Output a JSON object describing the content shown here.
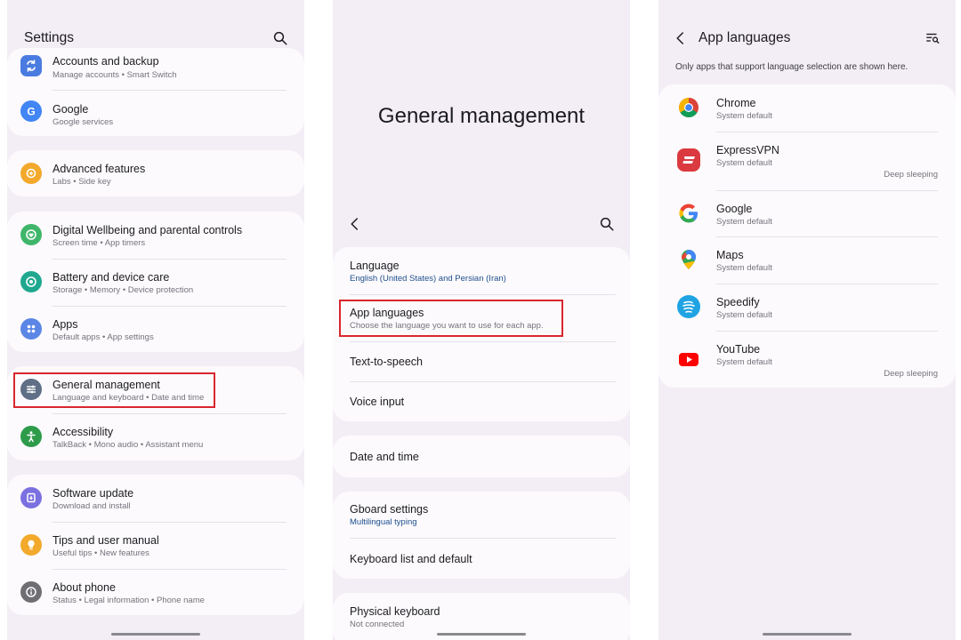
{
  "settings": {
    "title": "Settings",
    "groups": [
      {
        "items": [
          {
            "title": "Accounts and backup",
            "sub": "Manage accounts  •  Smart Switch",
            "icon": "sync-icon",
            "color": "#4a7be0"
          },
          {
            "title": "Google",
            "sub": "Google services",
            "icon": "google-g-icon",
            "color": "#4285f4"
          }
        ]
      },
      {
        "items": [
          {
            "title": "Advanced features",
            "sub": "Labs  •  Side key",
            "icon": "gear-plus-icon",
            "color": "#f3a92c"
          }
        ]
      },
      {
        "items": [
          {
            "title": "Digital Wellbeing and parental controls",
            "sub": "Screen time  •  App timers",
            "icon": "wellbeing-icon",
            "color": "#3fb66a"
          },
          {
            "title": "Battery and device care",
            "sub": "Storage  •  Memory  •  Device protection",
            "icon": "device-care-icon",
            "color": "#1fa88f"
          },
          {
            "title": "Apps",
            "sub": "Default apps  •  App settings",
            "icon": "apps-grid-icon",
            "color": "#5c86e6"
          }
        ]
      },
      {
        "items": [
          {
            "title": "General management",
            "sub": "Language and keyboard  •  Date and time",
            "icon": "sliders-icon",
            "color": "#5f6f86"
          },
          {
            "title": "Accessibility",
            "sub": "TalkBack  •  Mono audio  •  Assistant menu",
            "icon": "accessibility-icon",
            "color": "#2e9b4b"
          }
        ]
      },
      {
        "items": [
          {
            "title": "Software update",
            "sub": "Download and install",
            "icon": "update-icon",
            "color": "#7b70e0"
          },
          {
            "title": "Tips and user manual",
            "sub": "Useful tips  •  New features",
            "icon": "lightbulb-icon",
            "color": "#f3a92c"
          },
          {
            "title": "About phone",
            "sub": "Status  •  Legal information  •  Phone name",
            "icon": "info-icon",
            "color": "#6e6e73"
          }
        ]
      }
    ]
  },
  "general": {
    "title": "General management",
    "groups": [
      {
        "items": [
          {
            "title": "Language",
            "sub": "English (United States) and Persian (Iran)",
            "sub_blue": true
          },
          {
            "title": "App languages",
            "sub": "Choose the language you want to use for each app."
          },
          {
            "title": "Text-to-speech"
          },
          {
            "title": "Voice input"
          }
        ]
      },
      {
        "items": [
          {
            "title": "Date and time"
          }
        ]
      },
      {
        "items": [
          {
            "title": "Gboard settings",
            "sub": "Multilingual typing",
            "sub_blue": true
          },
          {
            "title": "Keyboard list and default"
          }
        ]
      },
      {
        "items": [
          {
            "title": "Physical keyboard",
            "sub": "Not connected"
          }
        ]
      }
    ]
  },
  "app_languages": {
    "title": "App languages",
    "note": "Only apps that support language selection are shown here.",
    "apps": [
      {
        "name": "Chrome",
        "status": "System default",
        "icon": "chrome-icon"
      },
      {
        "name": "ExpressVPN",
        "status": "System default",
        "extra": "Deep sleeping",
        "icon": "expressvpn-icon"
      },
      {
        "name": "Google",
        "status": "System default",
        "icon": "google-g-icon"
      },
      {
        "name": "Maps",
        "status": "System default",
        "icon": "maps-pin-icon"
      },
      {
        "name": "Speedify",
        "status": "System default",
        "icon": "speedify-icon"
      },
      {
        "name": "YouTube",
        "status": "System default",
        "extra": "Deep sleeping",
        "icon": "youtube-icon"
      }
    ]
  }
}
